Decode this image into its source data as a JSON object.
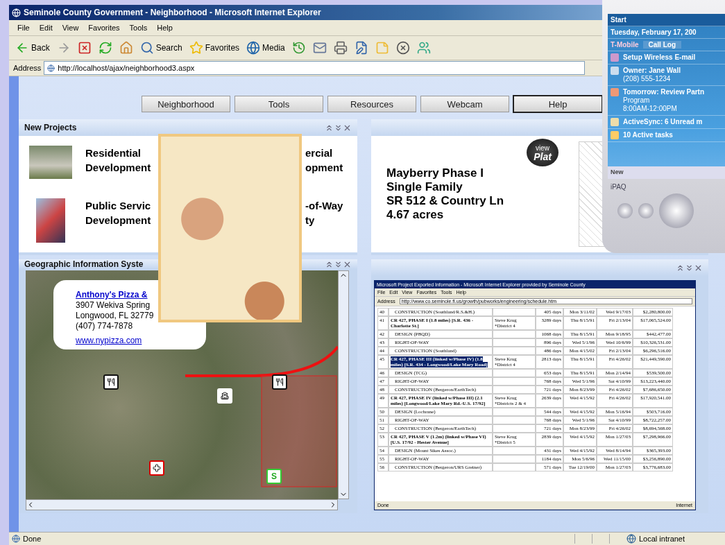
{
  "window": {
    "title": "Seminole County Government - Neighborhood - Microsoft Internet Explorer"
  },
  "menu": [
    "File",
    "Edit",
    "View",
    "Favorites",
    "Tools",
    "Help"
  ],
  "toolbar": [
    {
      "kind": "back",
      "label": "Back"
    },
    {
      "kind": "forward"
    },
    {
      "kind": "stop"
    },
    {
      "kind": "refresh"
    },
    {
      "kind": "home"
    },
    {
      "kind": "search",
      "label": "Search"
    },
    {
      "kind": "favorites",
      "label": "Favorites"
    },
    {
      "kind": "media",
      "label": "Media"
    },
    {
      "kind": "history"
    },
    {
      "kind": "mail"
    },
    {
      "kind": "print"
    },
    {
      "kind": "edit"
    },
    {
      "kind": "note"
    },
    {
      "kind": "block"
    },
    {
      "kind": "messenger"
    }
  ],
  "address": {
    "label": "Address",
    "value": "http://localhost/ajax/neighborhood3.aspx"
  },
  "nav": [
    {
      "label": "Neighborhood",
      "selected": false
    },
    {
      "label": "Tools",
      "selected": false
    },
    {
      "label": "Resources",
      "selected": false
    },
    {
      "label": "Webcam",
      "selected": false
    },
    {
      "label": "Help",
      "selected": true
    }
  ],
  "new_projects": {
    "title": "New Projects",
    "items": [
      {
        "kind": "house",
        "lines": [
          "Residential",
          "Development"
        ],
        "right_lines": [
          "ercial",
          "opment"
        ]
      },
      {
        "kind": "workers",
        "lines": [
          "Public Servic",
          "Development"
        ],
        "right_lines": [
          "-of-Way",
          "ty"
        ]
      }
    ]
  },
  "featured": {
    "lines": [
      "Mayberry Phase I",
      "Single Family",
      "SR 512 & Country Ln",
      "4.67 acres"
    ],
    "badge": [
      "view",
      "Plat"
    ]
  },
  "gis": {
    "title": "Geographic Information Syste",
    "popup": {
      "link": "Anthony's Pizza &",
      "lines": [
        "3907 Wekiva Spring",
        "Longwood, FL 32779",
        "(407) 774-7878"
      ],
      "url": "www.nypizza.com"
    },
    "markers": [
      {
        "kind": "restaurant"
      },
      {
        "kind": "restaurant"
      },
      {
        "kind": "school"
      },
      {
        "kind": "hospital"
      },
      {
        "kind": "label",
        "label": "S"
      }
    ]
  },
  "schedule": {
    "title": "Microsoft Project Exported Information - Microsoft Internet Explorer provided by Seminole County",
    "menu": [
      "File",
      "Edit",
      "View",
      "Favorites",
      "Tools",
      "Help"
    ],
    "address_label": "Address",
    "address": "http://www.co.seminole.fl.us/growth/pubworks/engineering/schedule.htm",
    "rows": [
      {
        "id": "40",
        "name": "CONSTRUCTION (Southland/R.S.&H.)",
        "bold": false,
        "owner": "",
        "duration": "405 days",
        "start": "Mon 3/11/02",
        "finish": "Wed 9/17/03",
        "cost": "$2,280,800.00",
        "selected": false
      },
      {
        "id": "41",
        "name": "CR 427, PHASE I (1.8 miles) [S.R. 436 - Charlotte St.]",
        "bold": true,
        "owner": "Steve Krug *District 4",
        "duration": "3289 days",
        "start": "Thu 8/15/91",
        "finish": "Fri 2/13/04",
        "cost": "$17,065,524.00",
        "selected": false
      },
      {
        "id": "42",
        "name": "DESIGN (PBQD)",
        "bold": false,
        "owner": "",
        "duration": "1068 days",
        "start": "Thu 8/15/91",
        "finish": "Mon 9/18/95",
        "cost": "$442,477.00",
        "selected": false
      },
      {
        "id": "43",
        "name": "RIGHT-OF-WAY",
        "bold": false,
        "owner": "",
        "duration": "896 days",
        "start": "Wed 5/1/96",
        "finish": "Wed 10/6/99",
        "cost": "$10,326,531.00",
        "selected": false
      },
      {
        "id": "44",
        "name": "CONSTRUCTION (Southland)",
        "bold": false,
        "owner": "",
        "duration": "486 days",
        "start": "Mon 4/15/02",
        "finish": "Fri 2/13/04",
        "cost": "$6,296,516.00",
        "selected": false
      },
      {
        "id": "45",
        "name": "CR 427, PHASE III (linked w/Phase IV) (1.8 miles) [S.R. 434 - Longwood/Lake Mary Road]",
        "bold": true,
        "owner": "Steve Krug *District 4",
        "duration": "2813 days",
        "start": "Thu 8/15/91",
        "finish": "Fri 4/26/02",
        "cost": "$21,449,590.00",
        "selected": true
      },
      {
        "id": "46",
        "name": "DESIGN (TCG)",
        "bold": false,
        "owner": "",
        "duration": "653 days",
        "start": "Thu 8/15/91",
        "finish": "Mon 2/14/94",
        "cost": "$539,500.00",
        "selected": false
      },
      {
        "id": "47",
        "name": "RIGHT-OF-WAY",
        "bold": false,
        "owner": "",
        "duration": "768 days",
        "start": "Wed 5/1/96",
        "finish": "Sat 4/10/99",
        "cost": "$13,223,440.00",
        "selected": false
      },
      {
        "id": "48",
        "name": "CONSTRUCTION (Bergeron/EarthTech)",
        "bold": false,
        "owner": "",
        "duration": "721 days",
        "start": "Mon 8/23/99",
        "finish": "Fri 4/26/02",
        "cost": "$7,686,650.00",
        "selected": false
      },
      {
        "id": "49",
        "name": "CR 427, PHASE IV (linked w/Phase III) (2.1 miles) [Longwood/Lake Mary Rd.-U.S. 17/92]",
        "bold": true,
        "owner": "Steve Krug *Districts 2 & 4",
        "duration": "2639 days",
        "start": "Wed 4/15/92",
        "finish": "Fri 4/26/02",
        "cost": "$17,920,541.00",
        "selected": false
      },
      {
        "id": "50",
        "name": "DESIGN (Lochrane)",
        "bold": false,
        "owner": "",
        "duration": "544 days",
        "start": "Wed 4/15/92",
        "finish": "Mon 5/16/94",
        "cost": "$503,716.00",
        "selected": false
      },
      {
        "id": "51",
        "name": "RIGHT-OF-WAY",
        "bold": false,
        "owner": "",
        "duration": "768 days",
        "start": "Wed 5/1/96",
        "finish": "Sat 4/10/99",
        "cost": "$8,722,257.00",
        "selected": false
      },
      {
        "id": "52",
        "name": "CONSTRUCTION (Bergeron/EarthTech)",
        "bold": false,
        "owner": "",
        "duration": "721 days",
        "start": "Mon 8/23/99",
        "finish": "Fri 4/26/02",
        "cost": "$8,694,568.00",
        "selected": false
      },
      {
        "id": "53",
        "name": "CR 427, PHASE V (1.2m) (linked w/Phase VI) [U.S. 17/92 - Hester Avenue]",
        "bold": true,
        "owner": "Steve Krug *District 5",
        "duration": "2839 days",
        "start": "Wed 4/15/92",
        "finish": "Mon 1/27/03",
        "cost": "$7,298,966.00",
        "selected": false
      },
      {
        "id": "54",
        "name": "DESIGN (Mount Sikes Assoc.)",
        "bold": false,
        "owner": "",
        "duration": "431 days",
        "start": "Wed 4/15/92",
        "finish": "Wed 8/14/94",
        "cost": "$365,393.00",
        "selected": false
      },
      {
        "id": "55",
        "name": "RIGHT-OF-WAY",
        "bold": false,
        "owner": "",
        "duration": "1184 days",
        "start": "Mon 5/6/96",
        "finish": "Wed 11/15/00",
        "cost": "$3,256,890.00",
        "selected": false
      },
      {
        "id": "56",
        "name": "CONSTRUCTION (Bergeron/URS Greiner)",
        "bold": false,
        "owner": "",
        "duration": "571 days",
        "start": "Tue 12/19/00",
        "finish": "Mon 1/27/03",
        "cost": "$3,776,683.00",
        "selected": false
      }
    ],
    "status": [
      "Done",
      "Internet"
    ]
  },
  "pda": {
    "start": "Start",
    "date": "Tuesday, February 17, 200",
    "carrier": "T-Mobile",
    "call_log": "Call Log",
    "items": [
      {
        "kind": "mail",
        "lines": [
          "Setup Wireless E-mail"
        ]
      },
      {
        "kind": "owner",
        "lines": [
          "Owner: Jane Wall",
          "(208) 555-1234"
        ]
      },
      {
        "kind": "calendar",
        "lines": [
          "Tomorrow: Review Partn",
          "Program",
          "8:00AM-12:00PM"
        ]
      },
      {
        "kind": "sync",
        "lines": [
          "ActiveSync: 6 Unread m"
        ]
      },
      {
        "kind": "tasks",
        "lines": [
          "10 Active tasks"
        ]
      }
    ],
    "softkey": "New",
    "brand": "iPAQ"
  },
  "status_bar": {
    "text": "Done",
    "zone": "Local intranet"
  }
}
